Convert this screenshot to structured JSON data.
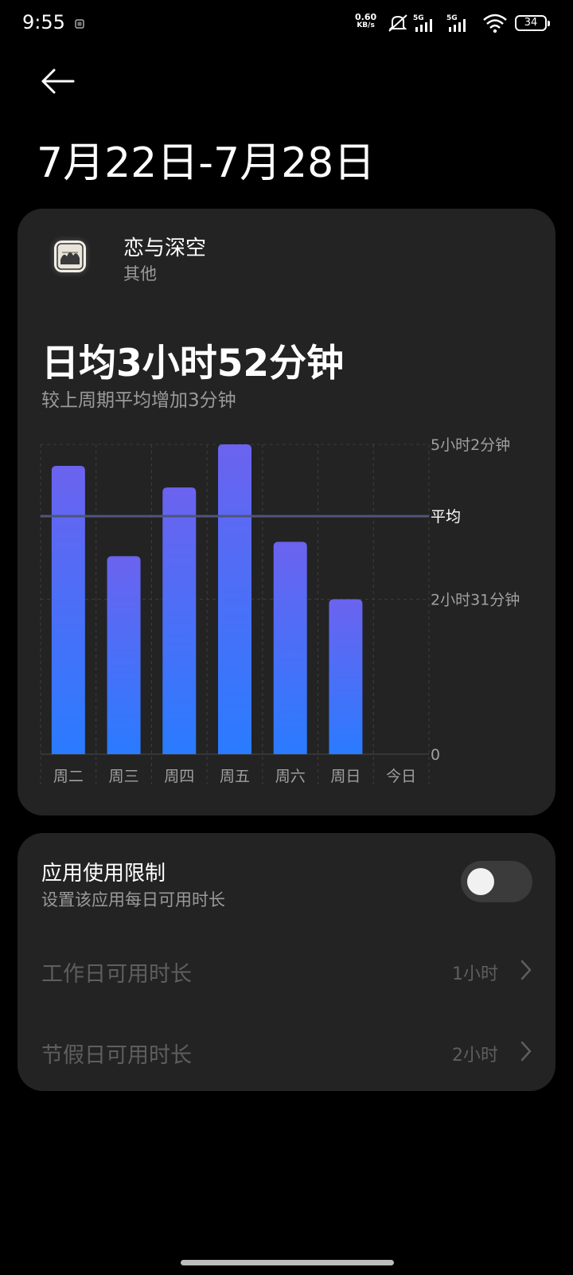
{
  "status_bar": {
    "time": "9:55",
    "net_speed_value": "0.60",
    "net_speed_unit": "KB/s",
    "signal1_label": "5G",
    "signal2_label": "5G",
    "battery": "34"
  },
  "header": {
    "back_icon": "arrow-left-icon",
    "title": "7月22日-7月28日"
  },
  "app": {
    "name": "恋与深空",
    "category": "其他"
  },
  "summary": {
    "daily_average": "日均3小时52分钟",
    "comparison": "较上周期平均增加3分钟"
  },
  "chart_data": {
    "type": "bar",
    "categories": [
      "周二",
      "周三",
      "周四",
      "周五",
      "周六",
      "周日",
      "今日"
    ],
    "values_minutes": [
      281,
      193,
      260,
      302,
      207,
      151,
      0
    ],
    "average_minutes": 232,
    "ylim_minutes": [
      0,
      302
    ],
    "y_tick_labels": [
      {
        "value": 302,
        "label": "5小时2分钟"
      },
      {
        "value": 232,
        "label": "平均"
      },
      {
        "value": 151,
        "label": "2小时31分钟"
      },
      {
        "value": 0,
        "label": "0"
      }
    ],
    "grid": true,
    "bar_color_top": "#6b63ef",
    "bar_color_bottom": "#2a7bff",
    "average_line_color": "#4f5478"
  },
  "limit": {
    "title": "应用使用限制",
    "subtitle": "设置该应用每日可用时长",
    "enabled": false,
    "workday_label": "工作日可用时长",
    "workday_value": "1小时",
    "holiday_label": "节假日可用时长",
    "holiday_value": "2小时"
  }
}
